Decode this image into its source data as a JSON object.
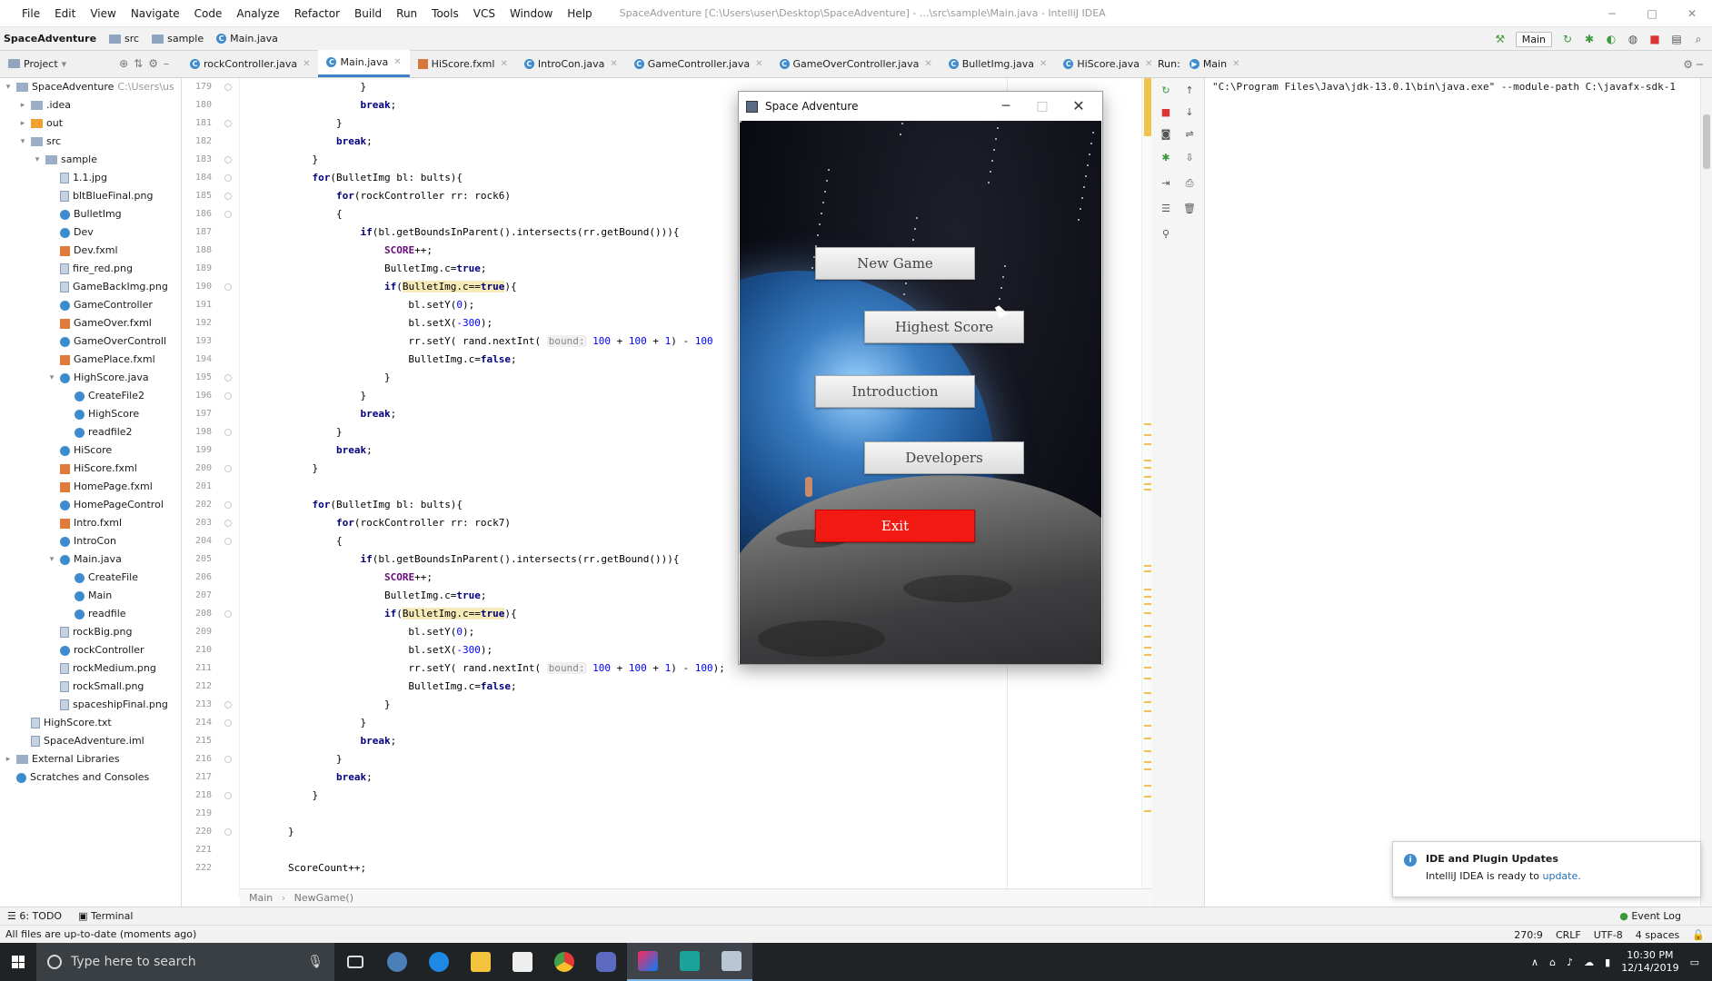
{
  "menu": [
    "File",
    "Edit",
    "View",
    "Navigate",
    "Code",
    "Analyze",
    "Refactor",
    "Build",
    "Run",
    "Tools",
    "VCS",
    "Window",
    "Help"
  ],
  "window_title": "SpaceAdventure [C:\\Users\\user\\Desktop\\SpaceAdventure] - ...\\src\\sample\\Main.java - IntelliJ IDEA",
  "breadcrumb": {
    "project": "SpaceAdventure",
    "src": "src",
    "sample": "sample",
    "file": "Main.java"
  },
  "run_config": "Main",
  "project_header": "Project",
  "tabs": [
    "rockController.java",
    "Main.java",
    "HiScore.fxml",
    "IntroCon.java",
    "GameController.java",
    "GameOverController.java",
    "BulletImg.java",
    "HiScore.java"
  ],
  "tree": [
    {
      "indent": 0,
      "arrow": "▾",
      "icon": "fold",
      "label": "SpaceAdventure",
      "extra": "C:\\Users\\us"
    },
    {
      "indent": 1,
      "arrow": "▸",
      "icon": "fold",
      "label": ".idea"
    },
    {
      "indent": 1,
      "arrow": "▸",
      "icon": "fold-orange",
      "label": "out"
    },
    {
      "indent": 1,
      "arrow": "▾",
      "icon": "fold",
      "label": "src"
    },
    {
      "indent": 2,
      "arrow": "▾",
      "icon": "fold",
      "label": "sample"
    },
    {
      "indent": 3,
      "arrow": "",
      "icon": "file",
      "label": "1.1.jpg"
    },
    {
      "indent": 3,
      "arrow": "",
      "icon": "file",
      "label": "bltBlueFinal.png"
    },
    {
      "indent": 3,
      "arrow": "",
      "icon": "c",
      "label": "BulletImg"
    },
    {
      "indent": 3,
      "arrow": "",
      "icon": "c",
      "label": "Dev"
    },
    {
      "indent": 3,
      "arrow": "",
      "icon": "xml",
      "label": "Dev.fxml"
    },
    {
      "indent": 3,
      "arrow": "",
      "icon": "file",
      "label": "fire_red.png"
    },
    {
      "indent": 3,
      "arrow": "",
      "icon": "file",
      "label": "GameBackImg.png"
    },
    {
      "indent": 3,
      "arrow": "",
      "icon": "c",
      "label": "GameController"
    },
    {
      "indent": 3,
      "arrow": "",
      "icon": "xml",
      "label": "GameOver.fxml"
    },
    {
      "indent": 3,
      "arrow": "",
      "icon": "c",
      "label": "GameOverControll"
    },
    {
      "indent": 3,
      "arrow": "",
      "icon": "xml",
      "label": "GamePlace.fxml"
    },
    {
      "indent": 3,
      "arrow": "▾",
      "icon": "c",
      "label": "HighScore.java"
    },
    {
      "indent": 4,
      "arrow": "",
      "icon": "c",
      "label": "CreateFile2"
    },
    {
      "indent": 4,
      "arrow": "",
      "icon": "c",
      "label": "HighScore"
    },
    {
      "indent": 4,
      "arrow": "",
      "icon": "c",
      "label": "readfile2"
    },
    {
      "indent": 3,
      "arrow": "",
      "icon": "c",
      "label": "HiScore"
    },
    {
      "indent": 3,
      "arrow": "",
      "icon": "xml",
      "label": "HiScore.fxml"
    },
    {
      "indent": 3,
      "arrow": "",
      "icon": "xml",
      "label": "HomePage.fxml"
    },
    {
      "indent": 3,
      "arrow": "",
      "icon": "c",
      "label": "HomePageControl"
    },
    {
      "indent": 3,
      "arrow": "",
      "icon": "xml",
      "label": "Intro.fxml"
    },
    {
      "indent": 3,
      "arrow": "",
      "icon": "c",
      "label": "IntroCon"
    },
    {
      "indent": 3,
      "arrow": "▾",
      "icon": "c",
      "label": "Main.java"
    },
    {
      "indent": 4,
      "arrow": "",
      "icon": "c",
      "label": "CreateFile"
    },
    {
      "indent": 4,
      "arrow": "",
      "icon": "c",
      "label": "Main"
    },
    {
      "indent": 4,
      "arrow": "",
      "icon": "c",
      "label": "readfile"
    },
    {
      "indent": 3,
      "arrow": "",
      "icon": "file",
      "label": "rockBig.png"
    },
    {
      "indent": 3,
      "arrow": "",
      "icon": "c",
      "label": "rockController"
    },
    {
      "indent": 3,
      "arrow": "",
      "icon": "file",
      "label": "rockMedium.png"
    },
    {
      "indent": 3,
      "arrow": "",
      "icon": "file",
      "label": "rockSmall.png"
    },
    {
      "indent": 3,
      "arrow": "",
      "icon": "file",
      "label": "spaceshipFinal.png"
    },
    {
      "indent": 1,
      "arrow": "",
      "icon": "file",
      "label": "HighScore.txt"
    },
    {
      "indent": 1,
      "arrow": "",
      "icon": "file",
      "label": "SpaceAdventure.iml"
    },
    {
      "indent": 0,
      "arrow": "▸",
      "icon": "lib",
      "label": "External Libraries"
    },
    {
      "indent": 0,
      "arrow": "",
      "icon": "scratch",
      "label": "Scratches and Consoles"
    }
  ],
  "line_numbers": [
    "179",
    "180",
    "181",
    "182",
    "183",
    "184",
    "185",
    "186",
    "187",
    "188",
    "189",
    "190",
    "191",
    "192",
    "193",
    "194",
    "195",
    "196",
    "197",
    "198",
    "199",
    "200",
    "201",
    "202",
    "203",
    "204",
    "205",
    "206",
    "207",
    "208",
    "209",
    "210",
    "211",
    "212",
    "213",
    "214",
    "215",
    "216",
    "217",
    "218",
    "219",
    "220",
    "221",
    "222"
  ],
  "code_lines": [
    "                    }",
    "                    break;",
    "                }",
    "                break;",
    "            }",
    "            for(BulletImg bl: bults){",
    "                for(rockController rr: rock6)",
    "                {",
    "                    if(bl.getBoundsInParent().intersects(rr.getBound())){",
    "                        SCORE++;",
    "                        BulletImg.c=true;",
    "                        if(BulletImg.c==true){",
    "                            bl.setY(0);",
    "                            bl.setX(-300);",
    "                            rr.setY( rand.nextInt( bound: 100 + 100 + 1) - 100",
    "                            BulletImg.c=false;",
    "                        }",
    "                    }",
    "                    break;",
    "                }",
    "                break;",
    "            }",
    "",
    "            for(BulletImg bl: bults){",
    "                for(rockController rr: rock7)",
    "                {",
    "                    if(bl.getBoundsInParent().intersects(rr.getBound())){",
    "                        SCORE++;",
    "                        BulletImg.c=true;",
    "                        if(BulletImg.c==true){",
    "                            bl.setY(0);",
    "                            bl.setX(-300);",
    "                            rr.setY( rand.nextInt( bound: 100 + 100 + 1) - 100);",
    "                            BulletImg.c=false;",
    "                        }",
    "                    }",
    "                    break;",
    "                }",
    "                break;",
    "            }",
    "",
    "        }",
    "",
    "        ScoreCount++;"
  ],
  "editor_breadcrumb": {
    "class": "Main",
    "method": "NewGame()"
  },
  "run": {
    "label": "Run:",
    "tab": "Main",
    "console_line": "\"C:\\Program Files\\Java\\jdk-13.0.1\\bin\\java.exe\" --module-path C:\\javafx-sdk-1"
  },
  "notification": {
    "title": "IDE and Plugin Updates",
    "body": "IntelliJ IDEA is ready to ",
    "link": "update."
  },
  "bottom_tabs": {
    "todo": "6: TODO",
    "terminal": "Terminal",
    "event_log": "Event Log"
  },
  "status": {
    "message": "All files are up-to-date (moments ago)",
    "position": "270:9",
    "line_sep": "CRLF",
    "encoding": "UTF-8",
    "indent": "4 spaces"
  },
  "app": {
    "title": "Space Adventure",
    "buttons": {
      "new_game": "New Game",
      "highest_score": "Highest Score",
      "introduction": "Introduction",
      "developers": "Developers",
      "exit": "Exit"
    }
  },
  "taskbar": {
    "search_placeholder": "Type here to search",
    "time": "10:30 PM",
    "date": "12/14/2019"
  },
  "colors": {
    "accent": "#4083c9",
    "exit_button": "#f01a12",
    "taskbar": "#1f2326"
  }
}
